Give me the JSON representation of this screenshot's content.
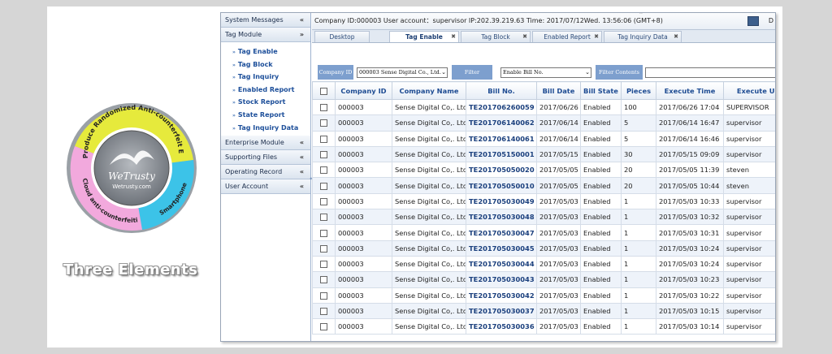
{
  "logo": {
    "brand": "WeTrusty",
    "site": "Wetrusty.com",
    "ring_top": "Produce Randomized Anti-counterfeit Embossed Tags",
    "ring_left": "Cloud anti-counterfeiting operation system",
    "ring_right": "Smartphone APP",
    "caption": "Three Elements",
    "colors": {
      "yellow": "#e6ea3c",
      "cyan": "#3cc3e8",
      "pink": "#f2a9dd",
      "center": "#8a8f96"
    }
  },
  "sidebar": {
    "sections": [
      {
        "label": "System Messages",
        "chevron": "«"
      },
      {
        "label": "Tag Module",
        "chevron": "»"
      }
    ],
    "tag_module_items": [
      "Tag Enable",
      "Tag Block",
      "Tag Inquiry",
      "Enabled Report",
      "Stock Report",
      "State Report",
      "Tag Inquiry Data"
    ],
    "lower_sections": [
      {
        "label": "Enterprise Module",
        "chevron": "«"
      },
      {
        "label": "Supporting Files",
        "chevron": "«"
      },
      {
        "label": "Operating Record",
        "chevron": "«"
      },
      {
        "label": "User Account",
        "chevron": "«"
      }
    ]
  },
  "infobar": {
    "text": "Company ID:000003 User account：supervisor IP:202.39.219.63 Time: 2017/07/12Wed. 13:56:06 (GMT+8)",
    "trailing": "D"
  },
  "tabs": [
    {
      "label": "Desktop",
      "closable": false
    },
    {
      "label": "Tag Enable",
      "closable": true,
      "active": true
    },
    {
      "label": "Tag Block",
      "closable": true
    },
    {
      "label": "Enabled Report",
      "closable": true
    },
    {
      "label": "Tag Inquiry Data",
      "closable": true
    }
  ],
  "filter": {
    "company_label": "Company ID",
    "company_value": "000003 Sense Digital Co., Ltd.",
    "filter_label": "Filter",
    "filter_value": "Enable Bill No.",
    "contents_label": "Filter Contents",
    "contents_value": ""
  },
  "table": {
    "headers": [
      "Company ID",
      "Company Name",
      "Bill No.",
      "Bill Date",
      "Bill State",
      "Pieces",
      "Execute Time",
      "Execute User"
    ],
    "rows": [
      [
        "000003",
        "Sense Digital Co,. Ltd.",
        "TE201706260059",
        "2017/06/26",
        "Enabled",
        "100",
        "2017/06/26 17:04",
        "SUPERVISOR"
      ],
      [
        "000003",
        "Sense Digital Co,. Ltd.",
        "TE201706140062",
        "2017/06/14",
        "Enabled",
        "5",
        "2017/06/14 16:47",
        "supervisor"
      ],
      [
        "000003",
        "Sense Digital Co,. Ltd.",
        "TE201706140061",
        "2017/06/14",
        "Enabled",
        "5",
        "2017/06/14 16:46",
        "supervisor"
      ],
      [
        "000003",
        "Sense Digital Co,. Ltd.",
        "TE201705150001",
        "2017/05/15",
        "Enabled",
        "30",
        "2017/05/15 09:09",
        "supervisor"
      ],
      [
        "000003",
        "Sense Digital Co,. Ltd.",
        "TE201705050020",
        "2017/05/05",
        "Enabled",
        "20",
        "2017/05/05 11:39",
        "steven"
      ],
      [
        "000003",
        "Sense Digital Co,. Ltd.",
        "TE201705050010",
        "2017/05/05",
        "Enabled",
        "20",
        "2017/05/05 10:44",
        "steven"
      ],
      [
        "000003",
        "Sense Digital Co,. Ltd.",
        "TE201705030049",
        "2017/05/03",
        "Enabled",
        "1",
        "2017/05/03 10:33",
        "supervisor"
      ],
      [
        "000003",
        "Sense Digital Co,. Ltd.",
        "TE201705030048",
        "2017/05/03",
        "Enabled",
        "1",
        "2017/05/03 10:32",
        "supervisor"
      ],
      [
        "000003",
        "Sense Digital Co,. Ltd.",
        "TE201705030047",
        "2017/05/03",
        "Enabled",
        "1",
        "2017/05/03 10:31",
        "supervisor"
      ],
      [
        "000003",
        "Sense Digital Co,. Ltd.",
        "TE201705030045",
        "2017/05/03",
        "Enabled",
        "1",
        "2017/05/03 10:24",
        "supervisor"
      ],
      [
        "000003",
        "Sense Digital Co,. Ltd.",
        "TE201705030044",
        "2017/05/03",
        "Enabled",
        "1",
        "2017/05/03 10:24",
        "supervisor"
      ],
      [
        "000003",
        "Sense Digital Co,. Ltd.",
        "TE201705030043",
        "2017/05/03",
        "Enabled",
        "1",
        "2017/05/03 10:23",
        "supervisor"
      ],
      [
        "000003",
        "Sense Digital Co,. Ltd.",
        "TE201705030042",
        "2017/05/03",
        "Enabled",
        "1",
        "2017/05/03 10:22",
        "supervisor"
      ],
      [
        "000003",
        "Sense Digital Co,. Ltd.",
        "TE201705030037",
        "2017/05/03",
        "Enabled",
        "1",
        "2017/05/03 10:15",
        "supervisor"
      ],
      [
        "000003",
        "Sense Digital Co,. Ltd.",
        "TE201705030036",
        "2017/05/03",
        "Enabled",
        "1",
        "2017/05/03 10:14",
        "supervisor"
      ]
    ]
  }
}
